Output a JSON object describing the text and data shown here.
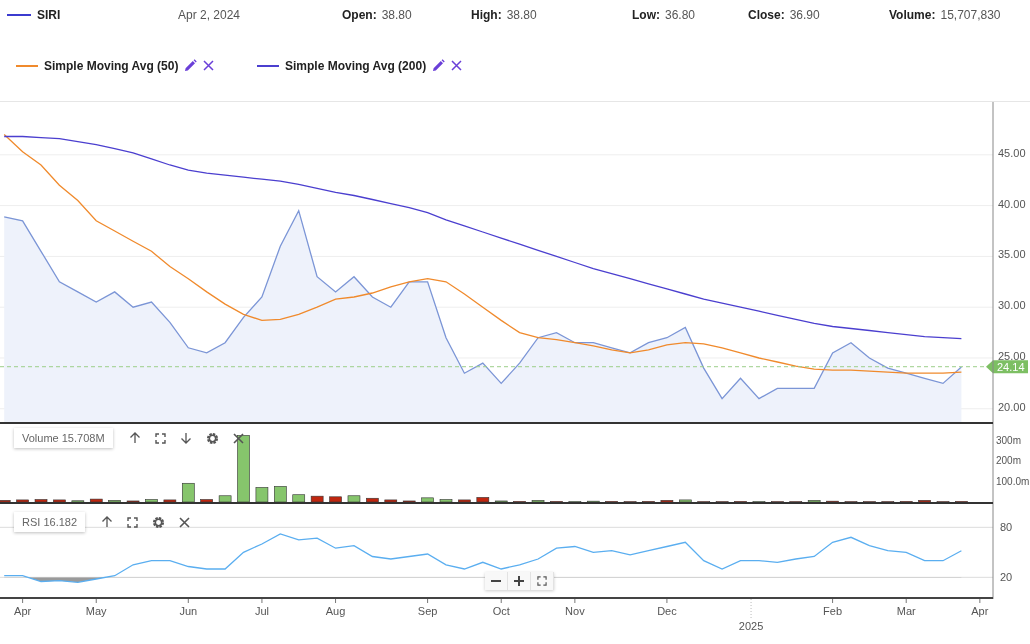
{
  "header": {
    "date": "Apr 2, 2024",
    "fields": [
      {
        "label": "Open:",
        "value": "38.80"
      },
      {
        "label": "High:",
        "value": "38.80"
      },
      {
        "label": "Low:",
        "value": "36.80"
      },
      {
        "label": "Close:",
        "value": "36.90"
      },
      {
        "label": "Volume:",
        "value": "15,707,830"
      }
    ]
  },
  "price_chart": {
    "chart_data": {
      "type": "line",
      "categories": [
        null,
        null,
        null,
        null,
        null,
        null,
        null,
        null,
        null,
        null,
        null,
        null,
        null,
        null,
        null,
        null,
        null,
        null,
        null,
        null,
        null,
        null,
        null,
        null,
        null,
        null,
        null,
        null,
        null,
        null,
        null,
        null,
        null,
        null,
        null,
        null,
        null,
        null,
        null,
        null,
        null,
        null,
        null,
        null,
        null,
        null,
        null,
        null,
        null,
        null,
        null,
        null,
        null,
        null
      ],
      "series": [
        {
          "name": "SIRI",
          "type": "area",
          "color": "#7b95d6",
          "values": [
            38.9,
            38.5,
            35.5,
            32.5,
            31.5,
            30.5,
            31.5,
            30,
            30.5,
            28.5,
            26,
            25.5,
            26.5,
            29,
            31,
            36,
            39.5,
            33,
            31.5,
            33,
            31,
            30,
            32.5,
            32.5,
            27,
            23.5,
            24.5,
            22.5,
            24.5,
            27,
            27.5,
            26.5,
            26.5,
            26,
            25.5,
            26.5,
            27,
            28,
            24,
            21,
            23,
            21,
            22,
            22,
            22,
            25.5,
            26.5,
            25,
            24,
            23.5,
            23,
            22.5,
            24.1,
            null
          ]
        },
        {
          "name": "Simple Moving Avg (50)",
          "color": "#f08a2c",
          "values": [
            47,
            45.3,
            44,
            42,
            40.5,
            38.5,
            37.5,
            36.5,
            35.5,
            34,
            32.8,
            31.5,
            30.3,
            29.3,
            28.7,
            28.8,
            29.3,
            30,
            30.8,
            31,
            31.4,
            32,
            32.5,
            32.8,
            32.5,
            31.3,
            30,
            28.7,
            27.5,
            27,
            26.8,
            26.5,
            26.2,
            25.8,
            25.5,
            25.8,
            26.3,
            26.5,
            26.4,
            26,
            25.5,
            25,
            24.6,
            24.2,
            23.9,
            23.8,
            23.8,
            23.7,
            23.6,
            23.5,
            23.5,
            23.5,
            23.6,
            null
          ]
        },
        {
          "name": "Simple Moving Avg (200)",
          "color": "#4b3fcf",
          "values": [
            46.8,
            46.8,
            46.7,
            46.6,
            46.3,
            46,
            45.6,
            45.2,
            44.6,
            44,
            43.5,
            43.2,
            43,
            42.8,
            42.6,
            42.4,
            42.1,
            41.7,
            41.3,
            41,
            40.6,
            40.2,
            39.8,
            39.3,
            38.6,
            38,
            37.4,
            36.8,
            36.2,
            35.6,
            35,
            34.4,
            33.8,
            33.3,
            32.8,
            32.3,
            31.8,
            31.3,
            30.8,
            30.4,
            30,
            29.6,
            29.2,
            28.8,
            28.4,
            28.1,
            27.9,
            27.7,
            27.5,
            27.3,
            27.1,
            27,
            26.9,
            null
          ]
        }
      ],
      "ylim": [
        18.5,
        50.2
      ],
      "yticks": [
        {
          "value": 20,
          "label": "20.00"
        },
        {
          "value": 25,
          "label": "25.00"
        },
        {
          "value": 30,
          "label": "30.00"
        },
        {
          "value": 35,
          "label": "35.00"
        },
        {
          "value": 40,
          "label": "40.00"
        },
        {
          "value": 45,
          "label": "45.00"
        }
      ],
      "grid": true,
      "ref_lines": [
        {
          "axis": "y",
          "value": 24.14,
          "label": "24.14"
        }
      ]
    }
  },
  "volume_chart": {
    "label": "Volume 15.708M",
    "chart_data": {
      "type": "bar",
      "categories": [
        null,
        null,
        null,
        null,
        null,
        null,
        null,
        null,
        null,
        null,
        null,
        null,
        null,
        null,
        null,
        null,
        null,
        null,
        null,
        null,
        null,
        null,
        null,
        null,
        null,
        null,
        null,
        null,
        null,
        null,
        null,
        null,
        null,
        null,
        null,
        null,
        null,
        null,
        null,
        null,
        null,
        null,
        null,
        null,
        null,
        null,
        null,
        null,
        null,
        null,
        null,
        null,
        null,
        null
      ],
      "series": [
        {
          "color": "#86c56c",
          "values": [
            null,
            null,
            null,
            null,
            6,
            null,
            8,
            null,
            12,
            null,
            90,
            null,
            30,
            320,
            70,
            75,
            35,
            null,
            null,
            30,
            null,
            null,
            null,
            20,
            12,
            null,
            null,
            5,
            null,
            8,
            null,
            2,
            4,
            null,
            null,
            null,
            null,
            10,
            null,
            null,
            null,
            2,
            null,
            null,
            8,
            null,
            null,
            null,
            null,
            null,
            null,
            null,
            null,
            null
          ]
        },
        {
          "color": "#c0260f",
          "values": [
            8,
            10,
            12,
            10,
            null,
            14,
            null,
            5,
            null,
            10,
            null,
            12,
            null,
            null,
            null,
            null,
            null,
            28,
            25,
            null,
            18,
            10,
            5,
            null,
            null,
            10,
            22,
            null,
            3,
            null,
            3,
            null,
            null,
            3,
            2,
            3,
            8,
            null,
            2,
            2,
            3,
            null,
            2,
            2,
            null,
            4,
            2,
            2,
            2,
            3,
            8,
            2,
            3,
            null
          ]
        }
      ],
      "ylim": [
        0,
        375
      ],
      "yticks": [
        {
          "value": 100,
          "label": "100.0m"
        },
        {
          "value": 200,
          "label": "200m"
        },
        {
          "value": 300,
          "label": "300m"
        }
      ]
    }
  },
  "rsi_chart": {
    "label": "RSI 16.182",
    "chart_data": {
      "type": "line",
      "categories": [
        null,
        "Apr",
        null,
        null,
        null,
        "May",
        null,
        null,
        null,
        null,
        "Jun",
        null,
        null,
        null,
        "Jul",
        null,
        null,
        null,
        "Aug",
        null,
        null,
        null,
        null,
        "Sep",
        null,
        null,
        null,
        "Oct",
        null,
        null,
        null,
        "Nov",
        null,
        null,
        null,
        null,
        "Dec",
        null,
        null,
        null,
        null,
        null,
        null,
        null,
        null,
        "Feb",
        null,
        null,
        null,
        "Mar",
        null,
        null,
        null,
        "Apr"
      ],
      "series": [
        {
          "color": "#5aaef0",
          "values": [
            22,
            22,
            15,
            16,
            14,
            18,
            22,
            35,
            40,
            40,
            33,
            30,
            30,
            50,
            60,
            72,
            65,
            67,
            55,
            58,
            45,
            42,
            45,
            48,
            35,
            30,
            38,
            30,
            35,
            42,
            55,
            57,
            50,
            52,
            47,
            52,
            57,
            62,
            40,
            30,
            40,
            40,
            38,
            42,
            45,
            62,
            68,
            58,
            52,
            50,
            40,
            40,
            52,
            null
          ]
        }
      ],
      "ylim": [
        -6,
        108
      ],
      "yticks": [
        20,
        80
      ],
      "annotations": [
        "2025"
      ]
    }
  }
}
